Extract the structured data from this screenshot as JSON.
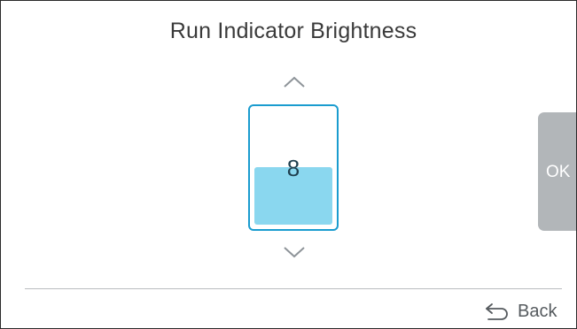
{
  "screen": {
    "title": "Run Indicator Brightness"
  },
  "brightness": {
    "value": "8",
    "fill_fraction": 0.5
  },
  "controls": {
    "increase_icon": "chevron-up-icon",
    "decrease_icon": "chevron-down-icon",
    "ok_label": "OK",
    "back_label": "Back",
    "back_icon": "undo-arrow-icon"
  },
  "colors": {
    "accent": "#1a9ccf",
    "fill": "#8ad7ef",
    "ok_button": "#b2b6b9"
  }
}
